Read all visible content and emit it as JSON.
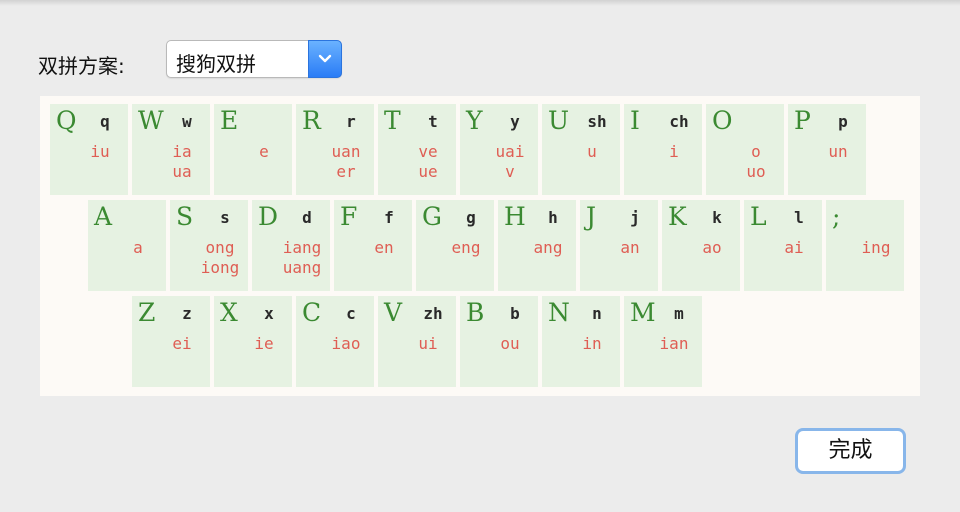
{
  "scheme": {
    "label": "双拼方案:",
    "selected": "搜狗双拼"
  },
  "keyboard": {
    "rows": [
      [
        {
          "k": "Q",
          "s": "q",
          "f": [
            "iu"
          ]
        },
        {
          "k": "W",
          "s": "w",
          "f": [
            "ia",
            "ua"
          ]
        },
        {
          "k": "E",
          "s": "",
          "f": [
            "e"
          ]
        },
        {
          "k": "R",
          "s": "r",
          "f": [
            "uan",
            "er"
          ]
        },
        {
          "k": "T",
          "s": "t",
          "f": [
            "ve",
            "ue"
          ]
        },
        {
          "k": "Y",
          "s": "y",
          "f": [
            "uai",
            "v"
          ]
        },
        {
          "k": "U",
          "s": "sh",
          "f": [
            "u"
          ]
        },
        {
          "k": "I",
          "s": "ch",
          "f": [
            "i"
          ]
        },
        {
          "k": "O",
          "s": "",
          "f": [
            "o",
            "uo"
          ]
        },
        {
          "k": "P",
          "s": "p",
          "f": [
            "un"
          ]
        }
      ],
      [
        {
          "k": "A",
          "s": "",
          "f": [
            "a"
          ]
        },
        {
          "k": "S",
          "s": "s",
          "f": [
            "ong",
            "iong"
          ]
        },
        {
          "k": "D",
          "s": "d",
          "f": [
            "iang",
            "uang"
          ]
        },
        {
          "k": "F",
          "s": "f",
          "f": [
            "en"
          ]
        },
        {
          "k": "G",
          "s": "g",
          "f": [
            "eng"
          ]
        },
        {
          "k": "H",
          "s": "h",
          "f": [
            "ang"
          ]
        },
        {
          "k": "J",
          "s": "j",
          "f": [
            "an"
          ]
        },
        {
          "k": "K",
          "s": "k",
          "f": [
            "ao"
          ]
        },
        {
          "k": "L",
          "s": "l",
          "f": [
            "ai"
          ]
        },
        {
          "k": ";",
          "s": "",
          "f": [
            "ing"
          ]
        }
      ],
      [
        {
          "k": "Z",
          "s": "z",
          "f": [
            "ei"
          ]
        },
        {
          "k": "X",
          "s": "x",
          "f": [
            "ie"
          ]
        },
        {
          "k": "C",
          "s": "c",
          "f": [
            "iao"
          ]
        },
        {
          "k": "V",
          "s": "zh",
          "f": [
            "ui"
          ]
        },
        {
          "k": "B",
          "s": "b",
          "f": [
            "ou"
          ]
        },
        {
          "k": "N",
          "s": "n",
          "f": [
            "in"
          ]
        },
        {
          "k": "M",
          "s": "m",
          "f": [
            "ian"
          ]
        }
      ]
    ]
  },
  "done_label": "完成",
  "icons": {
    "dropdown": "chevron-down-icon"
  },
  "colors": {
    "key_bg": "#e6f2e2",
    "key_letter": "#3b8a32",
    "final": "#df5e54",
    "select_arrow": "#2a7cf6",
    "focus_ring": "#88b6ea"
  }
}
